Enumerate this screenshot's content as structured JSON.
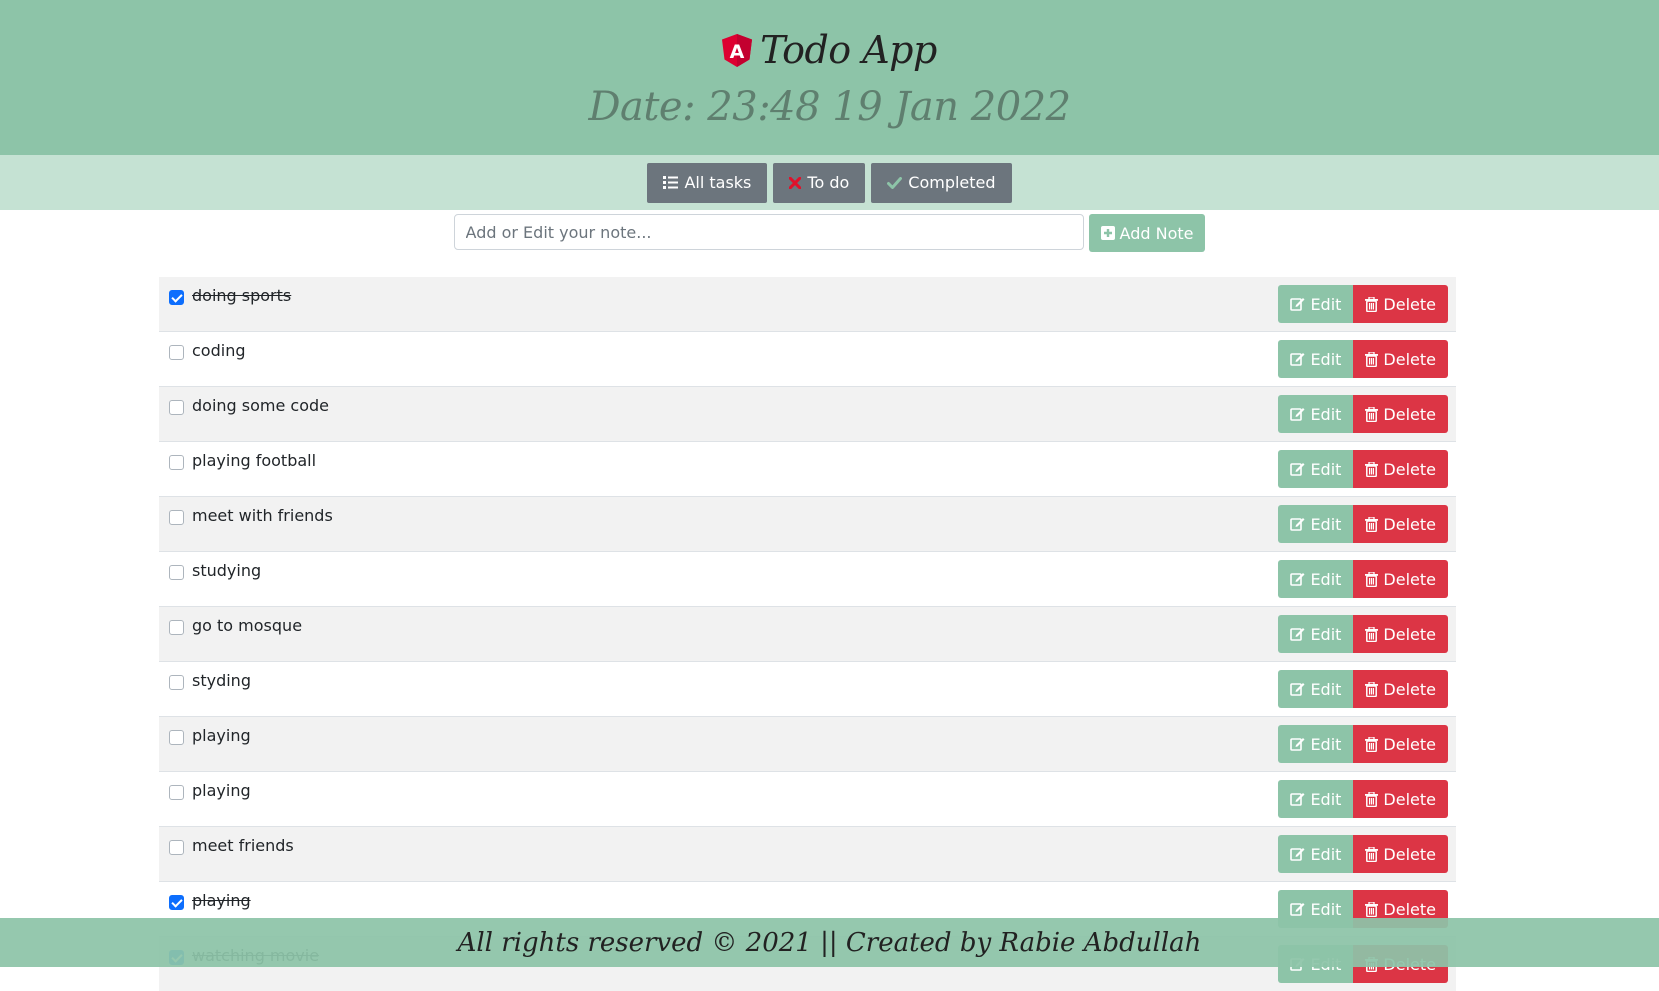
{
  "header": {
    "title": "Todo App",
    "date": "Date: 23:48 19 Jan 2022",
    "logo_icon": "angular-logo-icon",
    "logo_letter": "A"
  },
  "filters": {
    "all_label": "All tasks",
    "todo_label": "To do",
    "completed_label": "Completed"
  },
  "note_form": {
    "placeholder": "Add or Edit your note...",
    "value": "",
    "add_label": "Add Note"
  },
  "actions": {
    "edit_label": "Edit",
    "delete_label": "Delete"
  },
  "tasks": [
    {
      "text": "doing sports",
      "completed": true
    },
    {
      "text": "coding",
      "completed": false
    },
    {
      "text": "doing some code",
      "completed": false
    },
    {
      "text": "playing football",
      "completed": false
    },
    {
      "text": "meet with friends",
      "completed": false
    },
    {
      "text": "studying",
      "completed": false
    },
    {
      "text": "go to mosque",
      "completed": false
    },
    {
      "text": "styding",
      "completed": false
    },
    {
      "text": "playing",
      "completed": false
    },
    {
      "text": "playing",
      "completed": false
    },
    {
      "text": "meet friends",
      "completed": false
    },
    {
      "text": "playing",
      "completed": true
    },
    {
      "text": "watching movie",
      "completed": true
    }
  ],
  "footer": {
    "text": "All rights reserved © 2021 || Created by Rabie Abdullah"
  },
  "colors": {
    "header_bg": "#8dc4a8",
    "filter_bar_bg": "#c5e2d3",
    "edit_btn": "#8dc4a8",
    "delete_btn": "#dc3545",
    "filter_btn": "#6c757d",
    "checkbox_checked": "#0d6efd"
  }
}
